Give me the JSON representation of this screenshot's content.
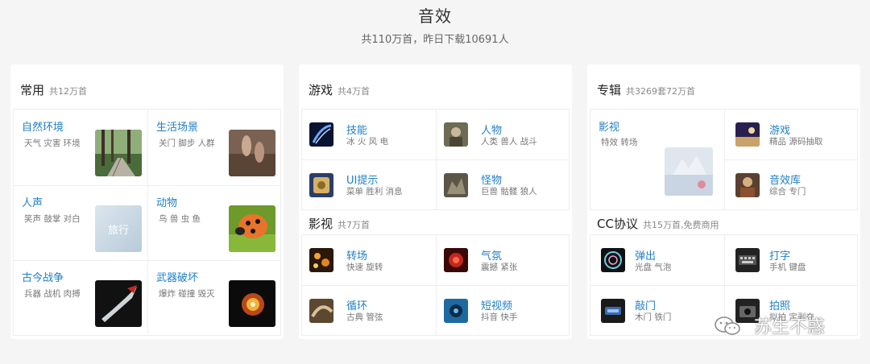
{
  "header": {
    "title": "音效",
    "subtitle": "共110万首，昨日下载10691人"
  },
  "sections": {
    "common": {
      "title": "常用",
      "count": "共12万首",
      "items": [
        {
          "name": "自然环境",
          "tags": "天气 灾害 环境"
        },
        {
          "name": "生活场景",
          "tags": "关门 脚步 人群"
        },
        {
          "name": "人声",
          "tags": "笑声 鼓掌 对白"
        },
        {
          "name": "动物",
          "tags": "鸟 兽 虫 鱼"
        },
        {
          "name": "古今战争",
          "tags": "兵器 战机 肉搏"
        },
        {
          "name": "武器破坏",
          "tags": "爆炸 碰撞 毁灭"
        }
      ]
    },
    "game": {
      "title": "游戏",
      "count": "共4万首",
      "items": [
        {
          "name": "技能",
          "tags": "冰 火 风 电"
        },
        {
          "name": "人物",
          "tags": "人类 兽人 战斗"
        },
        {
          "name": "UI提示",
          "tags": "菜单 胜利 消息"
        },
        {
          "name": "怪物",
          "tags": "巨兽 骷髅 狼人"
        }
      ]
    },
    "film": {
      "title": "影视",
      "count": "共7万首",
      "items": [
        {
          "name": "转场",
          "tags": "快速 旋转"
        },
        {
          "name": "气氛",
          "tags": "震撼 紧张"
        },
        {
          "name": "循环",
          "tags": "古典 管弦"
        },
        {
          "name": "短视频",
          "tags": "抖音 快手"
        }
      ]
    },
    "album": {
      "title": "专辑",
      "count": "共3269套72万首",
      "items": [
        {
          "name": "影视",
          "tags": "特效 转场"
        },
        {
          "name": "游戏",
          "tags": "精品 源码抽取"
        },
        {
          "name": "音效库",
          "tags": "综合 专门"
        }
      ]
    },
    "cc": {
      "title": "CC协议",
      "count": "共15万首,免费商用",
      "items": [
        {
          "name": "弹出",
          "tags": "光盘 气泡"
        },
        {
          "name": "打字",
          "tags": "手机 键盘"
        },
        {
          "name": "敲门",
          "tags": "木门 铁门"
        },
        {
          "name": "拍照",
          "tags": "拟拍 定剥夺"
        }
      ]
    }
  },
  "thumb_overlay_text": "旅行",
  "watermark": "苏生不惑"
}
